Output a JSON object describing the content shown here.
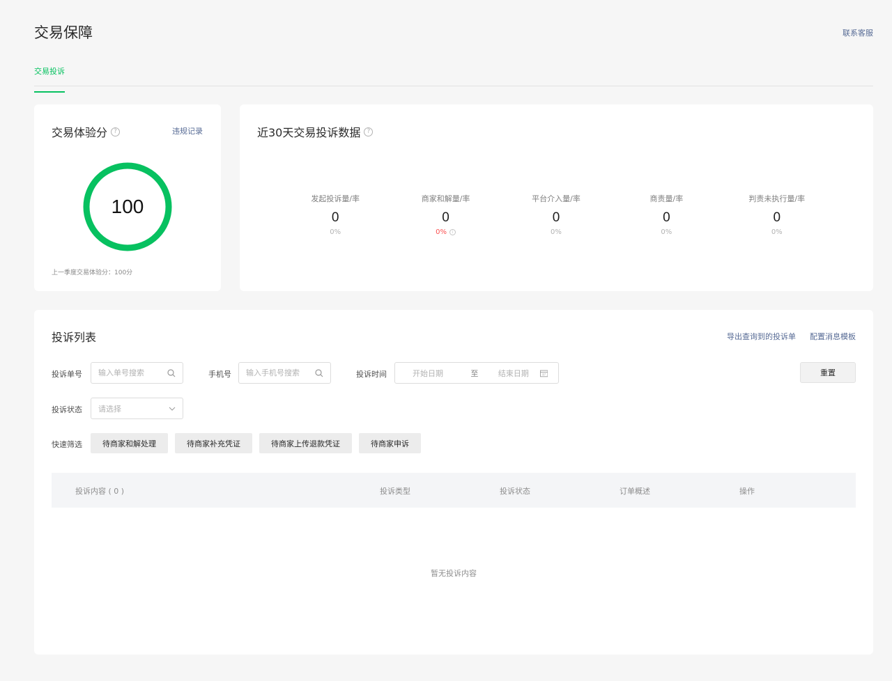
{
  "page": {
    "title": "交易保障",
    "contact": "联系客服"
  },
  "tabs": [
    {
      "label": "交易投诉",
      "active": true
    }
  ],
  "score_card": {
    "title": "交易体验分",
    "help_icon": "question-circle-icon",
    "violation_link": "违规记录",
    "score": "100",
    "score_level": 1.0,
    "ring_color": "#07c160",
    "note": "上一季度交易体验分：100分"
  },
  "data_card": {
    "title": "近30天交易投诉数据",
    "help_icon": "question-circle-icon",
    "stats": [
      {
        "label": "发起投诉量/率",
        "count": "0",
        "rate": "0%"
      },
      {
        "label": "商家和解量/率",
        "count": "0",
        "rate": "0%",
        "rate_color": "#fa5151",
        "info_icon": "info-circle-icon"
      },
      {
        "label": "平台介入量/率",
        "count": "0",
        "rate": "0%"
      },
      {
        "label": "商责量/率",
        "count": "0",
        "rate": "0%"
      },
      {
        "label": "判责未执行量/率",
        "count": "0",
        "rate": "0%"
      }
    ]
  },
  "list_card": {
    "title": "投诉列表",
    "export_link": "导出查询到的投诉单",
    "template_link": "配置消息模板",
    "filters": {
      "order_label": "投诉单号",
      "order_placeholder": "输入单号搜索",
      "phone_label": "手机号",
      "phone_placeholder": "输入手机号搜索",
      "time_label": "投诉时间",
      "start_placeholder": "开始日期",
      "range_sep": "至",
      "end_placeholder": "结束日期",
      "status_label": "投诉状态",
      "status_placeholder": "请选择",
      "reset": "重置",
      "quick_label": "快速筛选",
      "quick": [
        "待商家和解处理",
        "待商家补充凭证",
        "待商家上传退款凭证",
        "待商家申诉"
      ]
    },
    "table": {
      "columns": [
        "投诉内容 ( 0 )",
        "投诉类型",
        "投诉状态",
        "订单概述",
        "操作"
      ],
      "empty": "暂无投诉内容"
    }
  }
}
